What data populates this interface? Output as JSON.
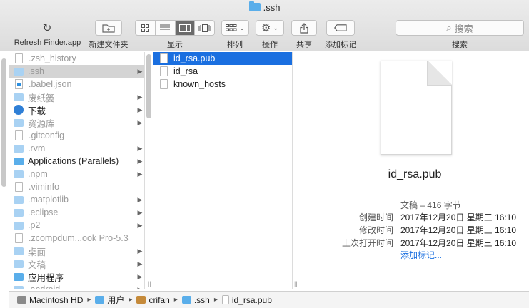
{
  "window": {
    "title": ".ssh"
  },
  "toolbar": {
    "refresh_label": "Refresh Finder.app",
    "new_folder_label": "新建文件夹",
    "view_label": "显示",
    "arrange_label": "排列",
    "action_label": "操作",
    "share_label": "共享",
    "tag_label": "添加标记",
    "search_label": "搜索",
    "search_placeholder": "搜索"
  },
  "column1": [
    {
      "name": ".zsh_history",
      "icon": "file-icon",
      "dim": true,
      "chevron": false
    },
    {
      "name": ".ssh",
      "icon": "folder-icon",
      "dim": true,
      "chevron": true,
      "selected": true
    },
    {
      "name": ".babel.json",
      "icon": "vscode-file-icon",
      "dim": true,
      "chevron": false
    },
    {
      "name": "废纸篓",
      "icon": "folder-icon",
      "dim": true,
      "chevron": true
    },
    {
      "name": "下载",
      "icon": "download-icon",
      "dim": false,
      "chevron": true
    },
    {
      "name": "资源库",
      "icon": "folder-icon",
      "dim": true,
      "chevron": true
    },
    {
      "name": ".gitconfig",
      "icon": "file-icon",
      "dim": true,
      "chevron": false
    },
    {
      "name": ".rvm",
      "icon": "folder-icon",
      "dim": true,
      "chevron": true
    },
    {
      "name": "Applications (Parallels)",
      "icon": "folder-icon",
      "dim": false,
      "chevron": true
    },
    {
      "name": ".npm",
      "icon": "folder-icon",
      "dim": true,
      "chevron": true
    },
    {
      "name": ".viminfo",
      "icon": "file-icon",
      "dim": true,
      "chevron": false
    },
    {
      "name": ".matplotlib",
      "icon": "folder-icon",
      "dim": true,
      "chevron": true
    },
    {
      "name": ".eclipse",
      "icon": "folder-icon",
      "dim": true,
      "chevron": true
    },
    {
      "name": ".p2",
      "icon": "folder-icon",
      "dim": true,
      "chevron": true
    },
    {
      "name": ".zcompdum...ook Pro-5.3",
      "icon": "file-icon",
      "dim": true,
      "chevron": false
    },
    {
      "name": "桌面",
      "icon": "folder-icon",
      "dim": true,
      "chevron": true
    },
    {
      "name": "文稿",
      "icon": "folder-icon",
      "dim": true,
      "chevron": true
    },
    {
      "name": "应用程序",
      "icon": "folder-icon",
      "dim": false,
      "chevron": true
    },
    {
      "name": ".android",
      "icon": "folder-icon",
      "dim": true,
      "chevron": true
    }
  ],
  "column2": [
    {
      "name": "id_rsa.pub",
      "selected": true
    },
    {
      "name": "id_rsa",
      "selected": false
    },
    {
      "name": "known_hosts",
      "selected": false
    }
  ],
  "preview": {
    "filename": "id_rsa.pub",
    "kind": "文稿 – 416 字节",
    "created_label": "创建时间",
    "created_value": "2017年12月20日 星期三 16:10",
    "modified_label": "修改时间",
    "modified_value": "2017年12月20日 星期三 16:10",
    "opened_label": "上次打开时间",
    "opened_value": "2017年12月20日 星期三 16:10",
    "add_tags": "添加标记..."
  },
  "pathbar": [
    {
      "label": "Macintosh HD",
      "icon": "disk-icon"
    },
    {
      "label": "用户",
      "icon": "users-folder-icon"
    },
    {
      "label": "crifan",
      "icon": "home-icon"
    },
    {
      "label": ".ssh",
      "icon": "folder-icon"
    },
    {
      "label": "id_rsa.pub",
      "icon": "file-icon"
    }
  ],
  "colors": {
    "selection": "#1a6fe0",
    "folder": "#5aaeea",
    "link": "#1a6fe0"
  }
}
